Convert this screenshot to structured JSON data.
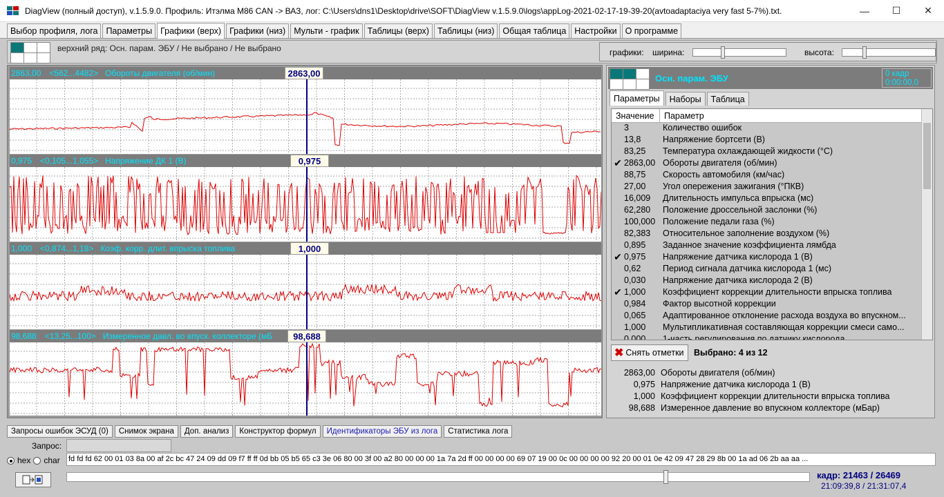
{
  "window": {
    "title": "DiagView (полный доступ), v.1.5.9.0. Профиль: Итэлма M86 CAN -> ВАЗ,   лог: C:\\Users\\dns1\\Desktop\\drive\\SOFT\\DiagView v.1.5.9.0\\logs\\appLog-2021-02-17-19-39-20(avtoadaptaciya very fast 5-7%).txt.",
    "minimize": "—",
    "maximize": "☐",
    "close": "✕"
  },
  "tabs": [
    {
      "label": "Выбор профиля, лога",
      "active": false
    },
    {
      "label": "Параметры",
      "active": false
    },
    {
      "label": "Графики (верх)",
      "active": true
    },
    {
      "label": "Графики (низ)",
      "active": false
    },
    {
      "label": "Мульти - график",
      "active": false
    },
    {
      "label": "Таблицы (верх)",
      "active": false
    },
    {
      "label": "Таблицы (низ)",
      "active": false
    },
    {
      "label": "Общая таблица",
      "active": false
    },
    {
      "label": "Настройки",
      "active": false
    },
    {
      "label": "О программе",
      "active": false
    }
  ],
  "toprow": {
    "text": "верхний ряд: Осн. парам. ЭБУ / Не выбрано / Не выбрано",
    "charts_label": "графики:",
    "width_label": "ширина:",
    "height_label": "высота:",
    "width_slider": 0.31,
    "height_slider": 0.22
  },
  "colors": {
    "accent_cyan": "#00e5ff",
    "plot_line": "#e00000",
    "cursor": "#000080",
    "checkmark": "#000000",
    "grid_on": "#0a7878"
  },
  "charts": [
    {
      "value": "2863,00",
      "range": "<562...4482>",
      "name": "Обороты двигателя (об/мин)",
      "cursor_value": "2863,00"
    },
    {
      "value": "0,975",
      "range": "<0,105...1,055>",
      "name": "Напряжение ДК 1 (В)",
      "cursor_value": "0,975"
    },
    {
      "value": "1,000",
      "range": "<0,874...1,18>",
      "name": "Коэф. корр. длит. впрыска топлива",
      "cursor_value": "1,000"
    },
    {
      "value": "98,688",
      "range": "<13,25...100>",
      "name": "Измеренное давл. во впуск. коллекторе (мБ",
      "cursor_value": "98,688"
    }
  ],
  "right_panel": {
    "title": "Осн. парам. ЭБУ",
    "frame_line1": "0 кадр",
    "frame_line2": "0:00:00,0",
    "tabs": [
      {
        "label": "Параметры",
        "active": true
      },
      {
        "label": "Наборы",
        "active": false
      },
      {
        "label": "Таблица",
        "active": false
      }
    ],
    "col_value": "Значение",
    "col_param": "Параметр",
    "rows": [
      {
        "checked": false,
        "value": "3",
        "name": "Количество ошибок"
      },
      {
        "checked": false,
        "value": "13,8",
        "name": "Напряжение бортсети (В)"
      },
      {
        "checked": false,
        "value": "83,25",
        "name": "Температура охлаждающей жидкости (°С)"
      },
      {
        "checked": true,
        "value": "2863,00",
        "name": "Обороты двигателя (об/мин)"
      },
      {
        "checked": false,
        "value": "88,75",
        "name": "Скорость автомобиля (км/час)"
      },
      {
        "checked": false,
        "value": "27,00",
        "name": "Угол опережения зажигания (°ПКВ)"
      },
      {
        "checked": false,
        "value": "16,009",
        "name": "Длительность импульса впрыска (мс)"
      },
      {
        "checked": false,
        "value": "62,280",
        "name": "Положение дроссельной заслонки (%)"
      },
      {
        "checked": false,
        "value": "100,000",
        "name": "Положение педали газа (%)"
      },
      {
        "checked": false,
        "value": "82,383",
        "name": "Относительное заполнение воздухом (%)"
      },
      {
        "checked": false,
        "value": "0,895",
        "name": "Заданное значение коэффициента лямбда"
      },
      {
        "checked": true,
        "value": "0,975",
        "name": "Напряжение датчика кислорода 1 (В)"
      },
      {
        "checked": false,
        "value": "0,62",
        "name": "Период сигнала датчика кислорода 1 (мс)"
      },
      {
        "checked": false,
        "value": "0,030",
        "name": "Напряжение датчика кислорода 2 (В)"
      },
      {
        "checked": true,
        "value": "1,000",
        "name": "Коэффициент коррекции длительности впрыска топлива"
      },
      {
        "checked": false,
        "value": "0,984",
        "name": "Фактор высотной коррекции"
      },
      {
        "checked": false,
        "value": "0,065",
        "name": "Адаптированное отклонение расхода воздуха во впускном..."
      },
      {
        "checked": false,
        "value": "1,000",
        "name": "Мультипликативная составляющая коррекции смеси само..."
      },
      {
        "checked": false,
        "value": "0,000",
        "name": "1-часть регулирования по датчику кислорода"
      }
    ],
    "unmark_label": "Снять отметки",
    "selected_count": "Выбрано: 4 из 12",
    "selected": [
      {
        "value": "2863,00",
        "name": "Обороты двигателя (об/мин)"
      },
      {
        "value": "0,975",
        "name": "Напряжение датчика кислорода 1 (В)"
      },
      {
        "value": "1,000",
        "name": "Коэффициент коррекции длительности впрыска топлива"
      },
      {
        "value": "98,688",
        "name": "Измеренное давление во впускном коллекторе (мБар)"
      }
    ]
  },
  "bottom": {
    "tabs": [
      {
        "label": "Запросы ошибок ЭСУД (0)",
        "active": false
      },
      {
        "label": "Снимок экрана",
        "active": false
      },
      {
        "label": "Доп. анализ",
        "active": false
      },
      {
        "label": "Конструктор формул",
        "active": false
      },
      {
        "label": "Идентификаторы ЭБУ из лога",
        "active": true
      },
      {
        "label": "Статистика лога",
        "active": false
      }
    ],
    "request_label": "Запрос:",
    "hex_label": "hex",
    "char_label": "char",
    "hex_data": "fd fd fd 62 00 01 03 8a 00 af 2c bc 47 24 09 dd 09 f7 ff ff 0d bb 05 b5 65 c3 3e 06 80 00 3f 00 a2 80 00 00 00 1a 7a 2d ff 00 00 00 00 69 07 19 00 0c 00 00 00 00 92 20 00 01 0e 42 09 47 28 29 8b 00 1a ad 06 2b aa aa ...",
    "frame": "кадр: 21463 / 26469",
    "time": "21:09:39,8 / 21:31:07,4",
    "position": 0.81
  }
}
